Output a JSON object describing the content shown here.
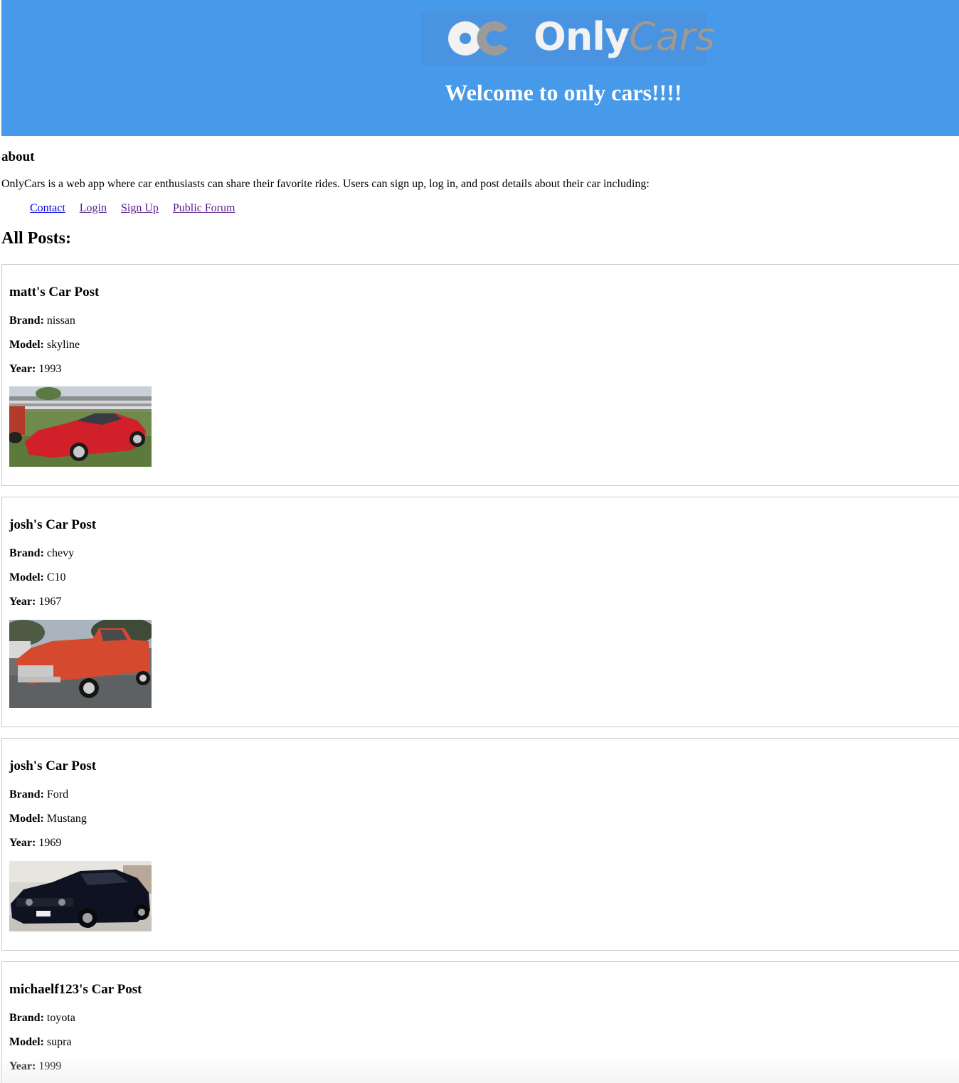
{
  "header": {
    "logo": {
      "mark": "OC",
      "word_bold": "Only",
      "word_script": "Cars"
    },
    "welcome": "Welcome to only cars!!!!"
  },
  "about": {
    "title": "about",
    "text": "OnlyCars is a web app where car enthusiasts can share their favorite rides. Users can sign up, log in, and post details about their car including:"
  },
  "nav": {
    "contact": "Contact",
    "login": "Login",
    "signup": "Sign Up",
    "forum": "Public Forum"
  },
  "posts_title": "All Posts:",
  "labels": {
    "brand": "Brand:",
    "model": "Model:",
    "year": "Year:"
  },
  "posts": [
    {
      "title": "matt's Car Post",
      "brand": "nissan",
      "model": "skyline",
      "year": "1993",
      "image": "red-sports-car"
    },
    {
      "title": "josh's Car Post",
      "brand": "chevy",
      "model": "C10",
      "year": "1967",
      "image": "orange-pickup-truck"
    },
    {
      "title": "josh's Car Post",
      "brand": "Ford",
      "model": "Mustang",
      "year": "1969",
      "image": "black-muscle-car"
    },
    {
      "title": "michaelf123's Car Post",
      "brand": "toyota",
      "model": "supra",
      "year": "1999"
    }
  ],
  "colors": {
    "header_bg": "#4799ea",
    "link": "#0000ee",
    "link_visited": "#551a8b",
    "card_border": "#c8c8c8"
  }
}
